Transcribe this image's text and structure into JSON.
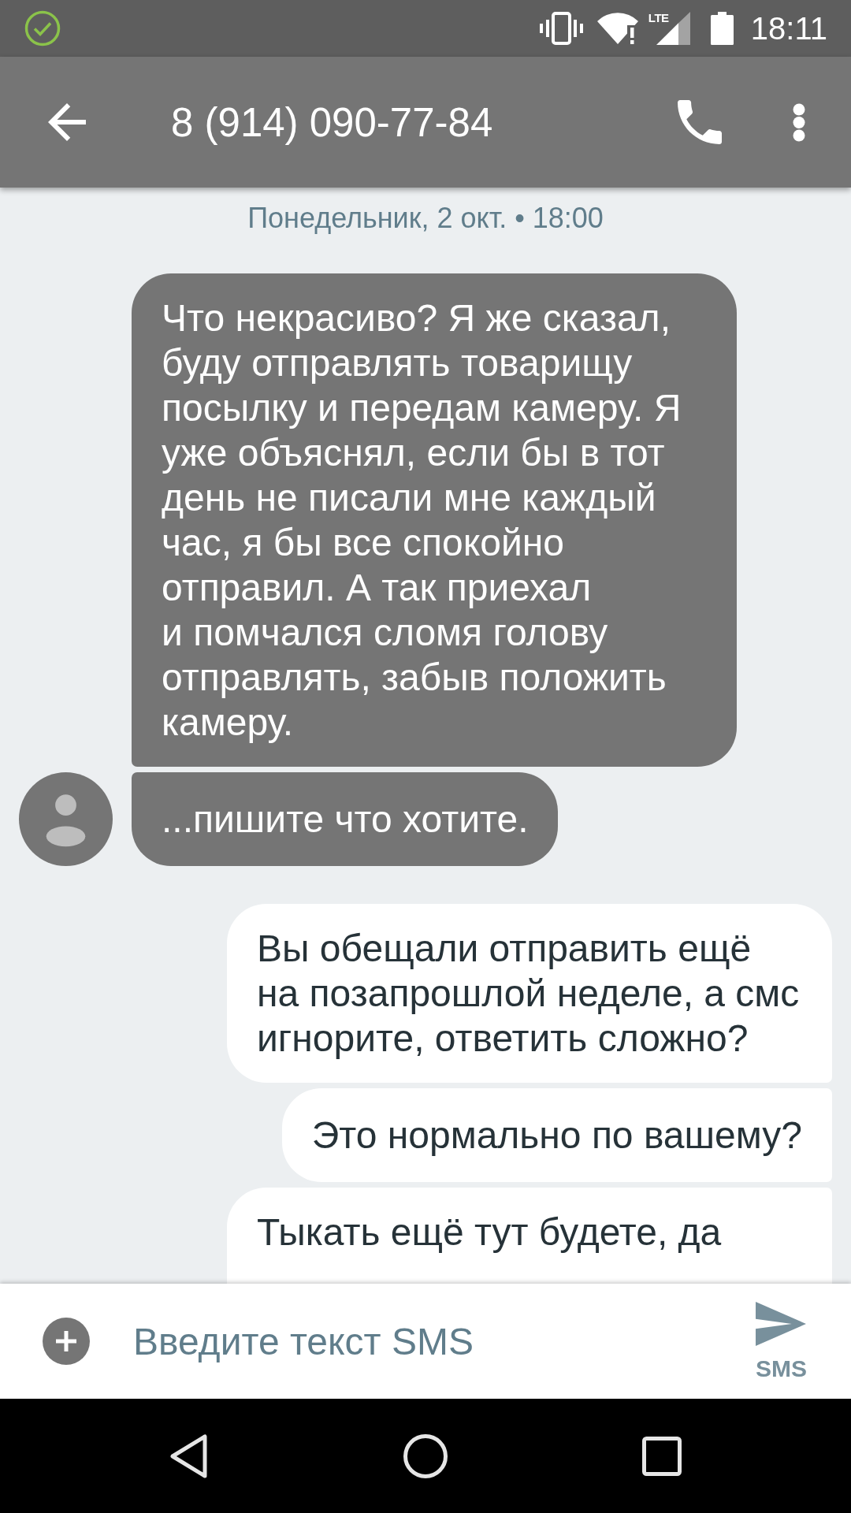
{
  "status_bar": {
    "network_type": "LTE",
    "time": "18:11"
  },
  "toolbar": {
    "title": "8 (914) 090-77-84"
  },
  "conversation": {
    "date_divider": "Понедельник, 2 окт. • 18:00",
    "messages": [
      {
        "kind": "incoming",
        "avatar": false,
        "cut_off": false,
        "text": "Что некрасиво? Я же сказал,\nбуду отправлять товарищу\nпосылку и передам камеру. Я\nуже объяснял, если бы в тот\nдень не писали мне каждый\nчас, я бы все спокойно\nотправил. А так приехал\nи помчался сломя голову\nотправлять, забыв положить\nкамеру."
      },
      {
        "kind": "incoming",
        "avatar": true,
        "cut_off": false,
        "text": "...пишите что хотите."
      },
      {
        "kind": "outgoing",
        "avatar": false,
        "cut_off": false,
        "text": "Вы обещали отправить ещё\nна позапрошлой неделе, а смс\nигнорите, ответить сложно?"
      },
      {
        "kind": "outgoing",
        "avatar": false,
        "cut_off": false,
        "text": "Это нормально по вашему?"
      },
      {
        "kind": "outgoing",
        "avatar": false,
        "cut_off": true,
        "text": "Тыкать ещё тут будете, да"
      }
    ]
  },
  "composer": {
    "placeholder": "Введите текст SMS",
    "send_label": "SMS"
  }
}
